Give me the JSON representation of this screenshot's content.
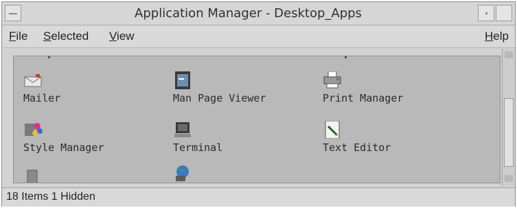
{
  "window": {
    "title": "Application Manager - Desktop_Apps"
  },
  "menubar": {
    "file": "File",
    "selected": "Selected",
    "view": "View",
    "help": "Help"
  },
  "apps": [
    {
      "label": "Mailer",
      "icon": "mailer-icon"
    },
    {
      "label": "Man Page Viewer",
      "icon": "man-page-viewer-icon"
    },
    {
      "label": "Print Manager",
      "icon": "print-manager-icon"
    },
    {
      "label": "Style Manager",
      "icon": "style-manager-icon"
    },
    {
      "label": "Terminal",
      "icon": "terminal-icon"
    },
    {
      "label": "Text Editor",
      "icon": "text-editor-icon"
    },
    {
      "label": "",
      "icon": "trash-icon"
    },
    {
      "label": "",
      "icon": "web-browser-icon"
    }
  ],
  "status": {
    "text": "18 Items 1 Hidden"
  },
  "colors": {
    "window_bg": "#d3d3d3",
    "pane_bg": "#b9b9b9"
  }
}
